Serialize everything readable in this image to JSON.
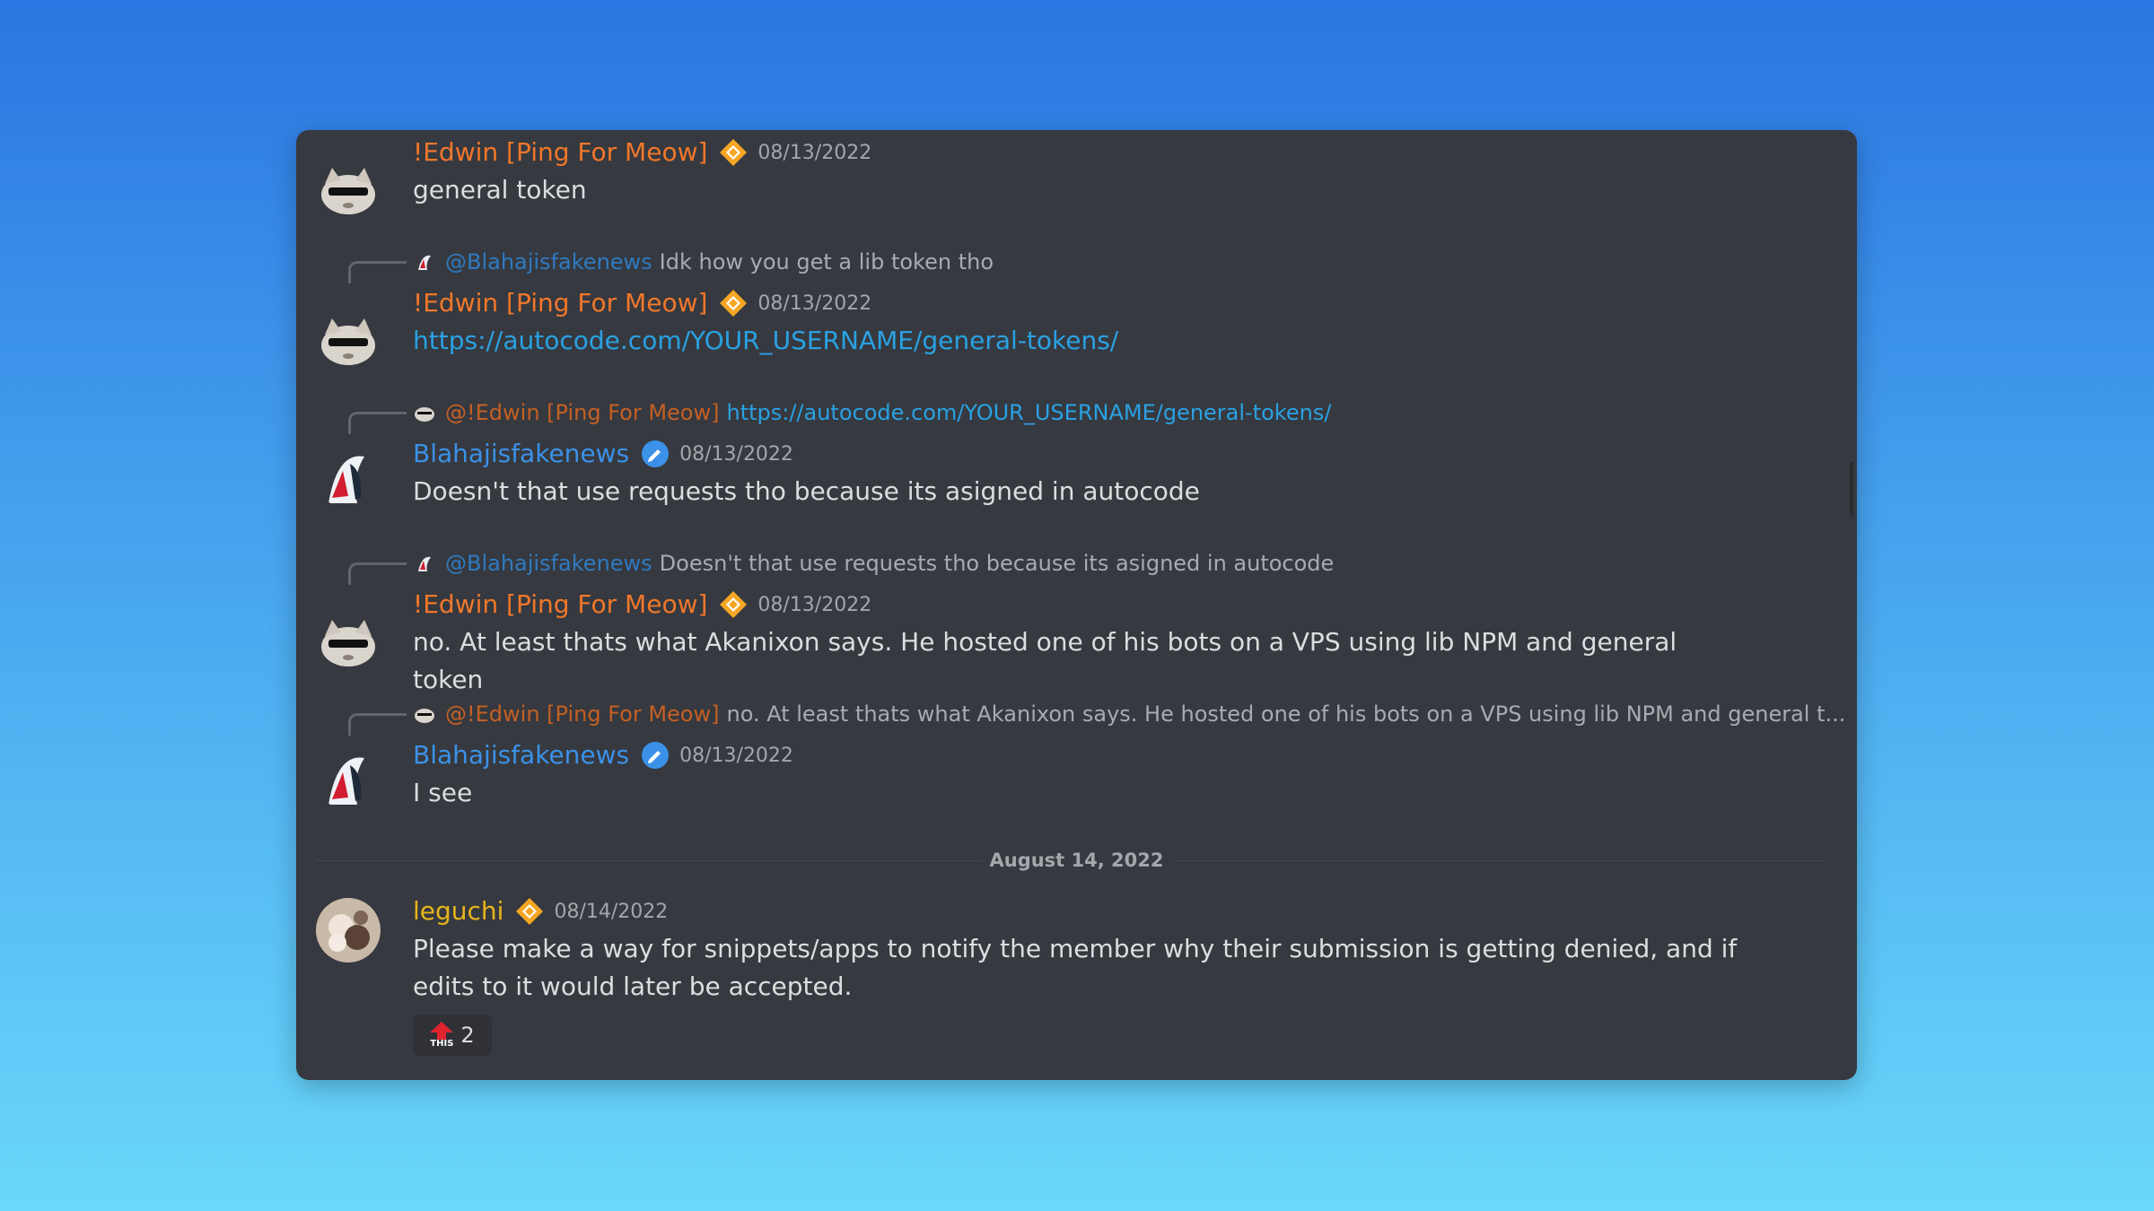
{
  "messages": [
    {
      "username": "!Edwin [Ping For Meow]",
      "timestamp": "08/13/2022",
      "text": "general token"
    },
    {
      "reply": {
        "mention": "@Blahajisfakenews",
        "text": "Idk how you get a lib token tho"
      },
      "username": "!Edwin [Ping For Meow]",
      "timestamp": "08/13/2022",
      "text": "https://autocode.com/YOUR_USERNAME/general-tokens/"
    },
    {
      "reply": {
        "mention": "@!Edwin [Ping For Meow]",
        "text": "https://autocode.com/YOUR_USERNAME/general-tokens/"
      },
      "username": "Blahajisfakenews",
      "timestamp": "08/13/2022",
      "text": "Doesn't that use requests tho because its asigned in autocode"
    },
    {
      "reply": {
        "mention": "@Blahajisfakenews",
        "text": "Doesn't that use requests tho because its asigned in autocode"
      },
      "username": "!Edwin [Ping For Meow]",
      "timestamp": "08/13/2022",
      "text": "no. At least thats what Akanixon says. He hosted one of his bots on a VPS using lib NPM and general token"
    },
    {
      "reply": {
        "mention": "@!Edwin [Ping For Meow]",
        "text": "no. At least thats what Akanixon says. He hosted one of his bots on a VPS using lib NPM and general t..."
      },
      "username": "Blahajisfakenews",
      "timestamp": "08/13/2022",
      "text": "I see"
    },
    {
      "username": "leguchi",
      "timestamp": "08/14/2022",
      "text": "Please make a way for snippets/apps to notify the member why their submission is getting denied, and if edits to it would later be accepted."
    }
  ],
  "date_divider": "August 14, 2022",
  "reaction": {
    "label": "THIS",
    "count": "2"
  },
  "colors": {
    "edwin": "#f0772b",
    "blahaj": "#3b91e8",
    "leguchi": "#e7b51c",
    "link": "#2aa1e3",
    "background": "#36393f"
  },
  "icons": {
    "edwin_badge": "orange-diamond-badge-icon",
    "blahaj_badge": "blue-verified-badge-icon",
    "leguchi_badge": "orange-diamond-badge-icon"
  }
}
